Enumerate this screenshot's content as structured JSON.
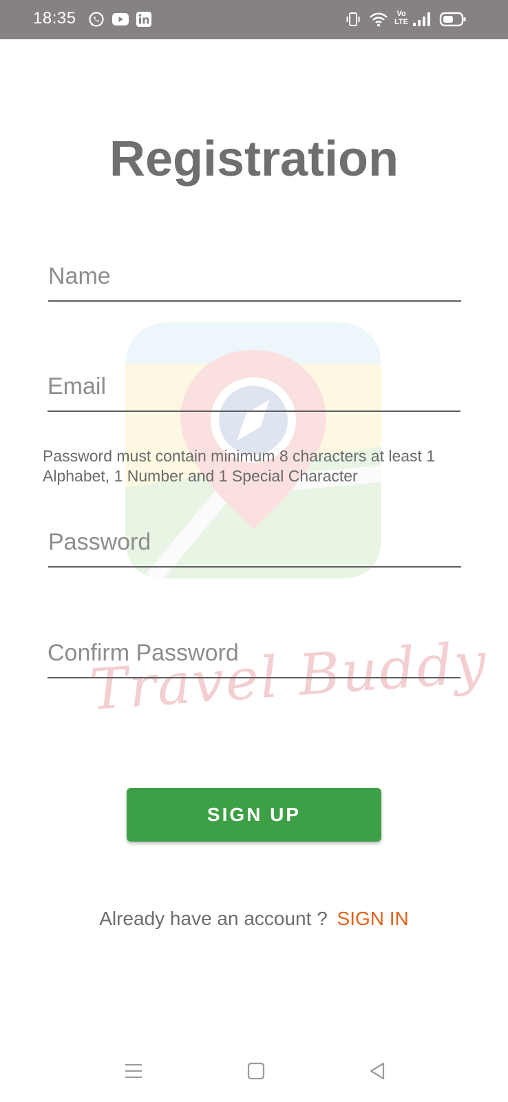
{
  "status_bar": {
    "time": "18:35",
    "notification_icons": [
      "whatsapp-icon",
      "youtube-icon",
      "linkedin-icon"
    ],
    "system_icons": [
      "vibrate-icon",
      "wifi-icon",
      "volte-icon",
      "signal-icon",
      "battery-icon"
    ],
    "volte_label_top": "Vo",
    "volte_label_bottom": "LTE",
    "background": "#858281"
  },
  "page": {
    "title": "Registration"
  },
  "form": {
    "name_placeholder": "Name",
    "email_placeholder": "Email",
    "password_hint": "Password must contain minimum 8 characters at least 1 Alphabet, 1 Number and 1 Special Character",
    "password_placeholder": "Password",
    "confirm_password_placeholder": "Confirm Password"
  },
  "watermark": {
    "text": "Travel Buddy"
  },
  "actions": {
    "signup_label": "SIGN UP",
    "signup_color": "#3ea046",
    "signin_prompt": "Already have an account ?",
    "signin_label": "SIGN IN",
    "signin_color": "#e0621a"
  },
  "nav_bar": {
    "icons": [
      "menu-icon",
      "home-icon",
      "back-icon"
    ]
  }
}
